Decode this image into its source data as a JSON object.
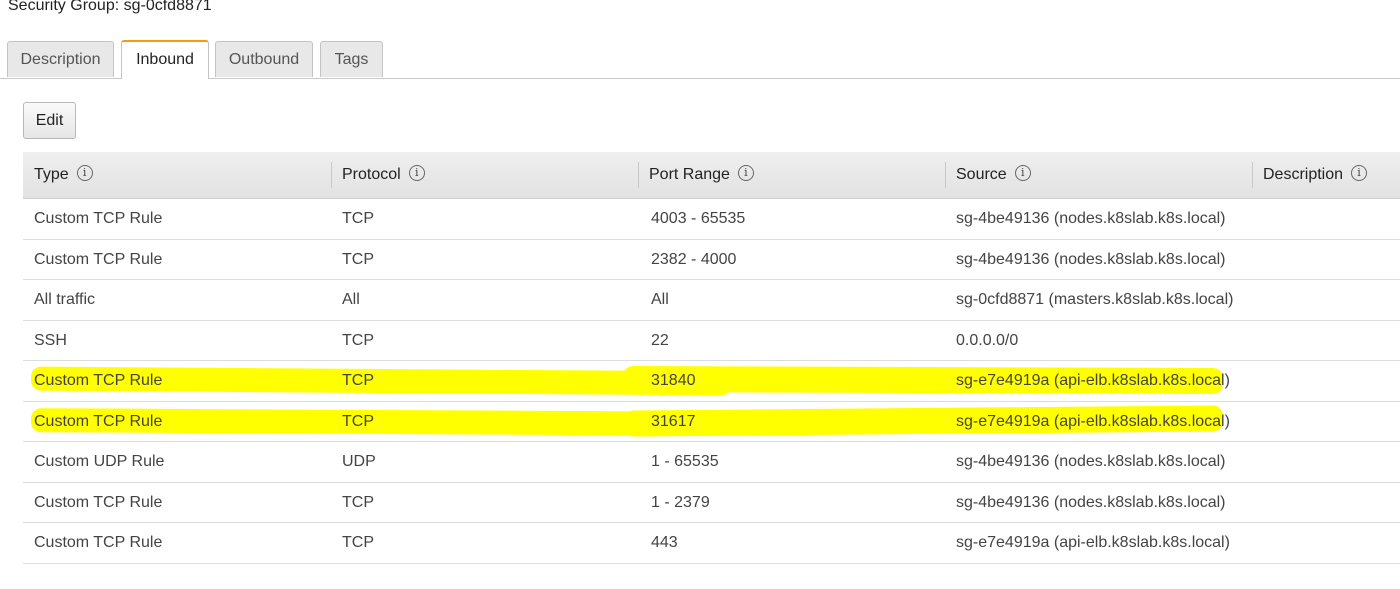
{
  "header": {
    "title": "Security Group: sg-0cfd8871"
  },
  "tabs": [
    {
      "label": "Description",
      "active": false
    },
    {
      "label": "Inbound",
      "active": true
    },
    {
      "label": "Outbound",
      "active": false
    },
    {
      "label": "Tags",
      "active": false
    }
  ],
  "toolbar": {
    "edit_label": "Edit"
  },
  "table": {
    "columns": [
      "Type",
      "Protocol",
      "Port Range",
      "Source",
      "Description"
    ],
    "info_glyph": "i",
    "rows": [
      {
        "type": "Custom TCP Rule",
        "protocol": "TCP",
        "port_range": "4003 - 65535",
        "source": "sg-4be49136 (nodes.k8slab.k8s.local)",
        "highlighted": false
      },
      {
        "type": "Custom TCP Rule",
        "protocol": "TCP",
        "port_range": "2382 - 4000",
        "source": "sg-4be49136 (nodes.k8slab.k8s.local)",
        "highlighted": false
      },
      {
        "type": "All traffic",
        "protocol": "All",
        "port_range": "All",
        "source": "sg-0cfd8871 (masters.k8slab.k8s.local)",
        "highlighted": false
      },
      {
        "type": "SSH",
        "protocol": "TCP",
        "port_range": "22",
        "source": "0.0.0.0/0",
        "highlighted": false
      },
      {
        "type": "Custom TCP Rule",
        "protocol": "TCP",
        "port_range": "31840",
        "source": "sg-e7e4919a (api-elb.k8slab.k8s.local)",
        "highlighted": true
      },
      {
        "type": "Custom TCP Rule",
        "protocol": "TCP",
        "port_range": "31617",
        "source": "sg-e7e4919a (api-elb.k8slab.k8s.local)",
        "highlighted": true
      },
      {
        "type": "Custom UDP Rule",
        "protocol": "UDP",
        "port_range": "1 - 65535",
        "source": "sg-4be49136 (nodes.k8slab.k8s.local)",
        "highlighted": false
      },
      {
        "type": "Custom TCP Rule",
        "protocol": "TCP",
        "port_range": "1 - 2379",
        "source": "sg-4be49136 (nodes.k8slab.k8s.local)",
        "highlighted": false
      },
      {
        "type": "Custom TCP Rule",
        "protocol": "TCP",
        "port_range": "443",
        "source": "sg-e7e4919a (api-elb.k8slab.k8s.local)",
        "highlighted": false
      }
    ]
  },
  "colors": {
    "highlight": "#ffff00",
    "active_tab_accent": "#f39c12"
  }
}
